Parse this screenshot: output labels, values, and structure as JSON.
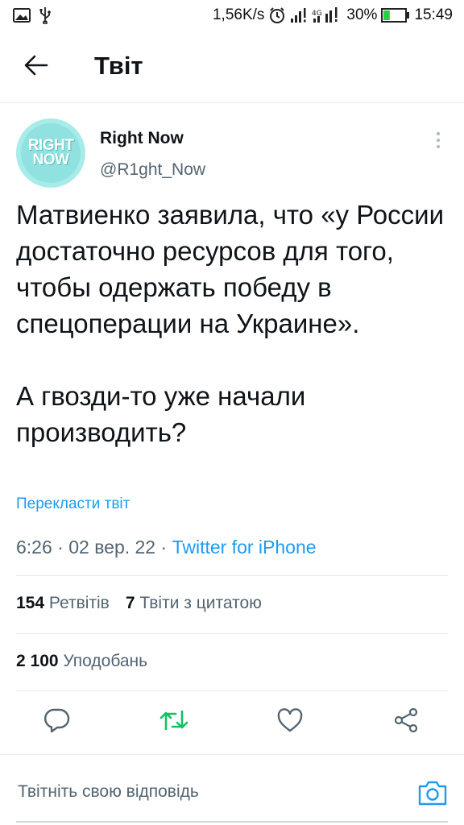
{
  "status_bar": {
    "speed": "1,56K/s",
    "network_type": "4G",
    "battery_percent": "30%",
    "battery_level": 0.3,
    "time": "15:49",
    "icons": [
      "gallery-icon",
      "usb-icon",
      "alarm-icon",
      "signal-icon",
      "signal-4g-icon",
      "battery-icon"
    ]
  },
  "header": {
    "title": "Твіт",
    "back_icon": "arrow-left-icon"
  },
  "tweet": {
    "avatar_text_line1": "RIGHT",
    "avatar_text_line2": "NOW",
    "display_name": "Right Now",
    "handle": "@R1ght_Now",
    "text_paragraph_1": "Матвиенко заявила, что «у России достаточно ресурсов для того, чтобы одержать победу в спецоперации на Украине».",
    "text_paragraph_2": "А гвозди-то уже начали производить?",
    "translate_label": "Перекласти твіт",
    "time": "6:26",
    "date": "02 вер. 22",
    "source": "Twitter for iPhone",
    "separator": "·"
  },
  "stats": {
    "retweets_count": "154",
    "retweets_label": "Ретвітів",
    "quotes_count": "7",
    "quotes_label": "Твіти з цитатою",
    "likes_count": "2 100",
    "likes_label": "Уподобань"
  },
  "actions": {
    "reply_icon": "reply-icon",
    "retweet_icon": "retweet-icon",
    "like_icon": "heart-icon",
    "share_icon": "share-icon"
  },
  "reply_bar": {
    "placeholder": "Твітніть свою відповідь",
    "camera_icon": "camera-icon"
  },
  "colors": {
    "accent": "#1d9bf0",
    "retweet_green": "#17bf63",
    "avatar_bg": "#a8ecea",
    "text_primary": "#0f1419",
    "text_secondary": "#536471"
  }
}
